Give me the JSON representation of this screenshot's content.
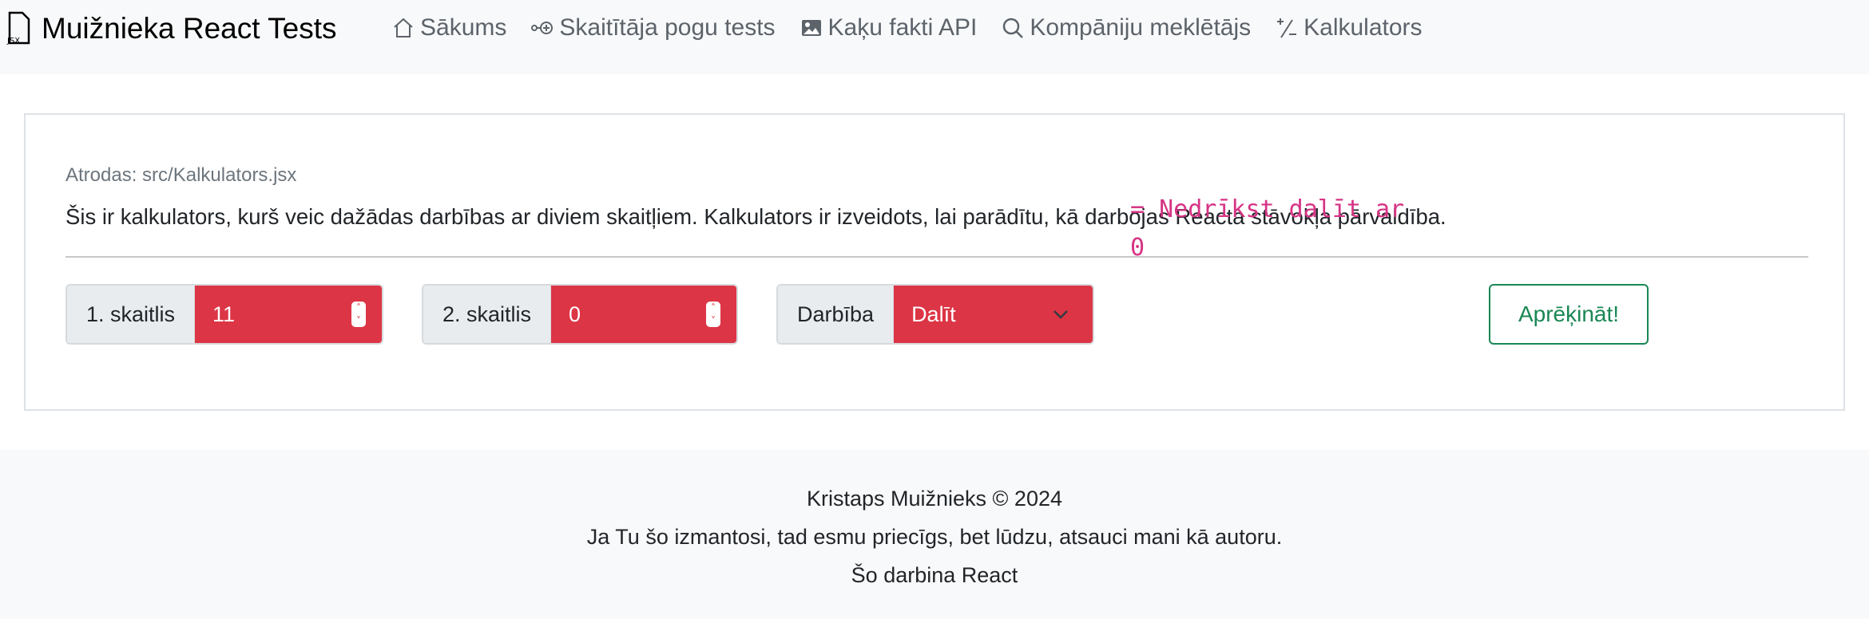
{
  "nav": {
    "brand": "Muižnieka React Tests",
    "brand_icon": "jsx-file-icon",
    "links": [
      {
        "label": "Sākums",
        "icon": "house-icon"
      },
      {
        "label": "Skaitītāja pogu tests",
        "icon": "node-plus-icon"
      },
      {
        "label": "Kaķu fakti API",
        "icon": "image-icon"
      },
      {
        "label": "Kompāniju meklētājs",
        "icon": "search-icon"
      },
      {
        "label": "Kalkulators",
        "icon": "plus-slash-minus-icon"
      }
    ]
  },
  "card": {
    "location": "Atrodas: src/Kalkulators.jsx",
    "description": "Šis ir kalkulators, kurš veic dažādas darbības ar diviem skaitļiem. Kalkulators ir izveidots, lai parādītu, kā darbojas Reacta stāvokļa pārvaldība.",
    "number1": {
      "label": "1. skaitlis",
      "value": "11"
    },
    "number2": {
      "label": "2. skaitlis",
      "value": "0"
    },
    "operation": {
      "label": "Darbība",
      "value": "Dalīt"
    },
    "result": "= Nedrīkst dalīt ar 0",
    "calculate_label": "Aprēķināt!",
    "colors": {
      "invalid": "#dc3545",
      "result": "#d63384",
      "button": "#198754"
    }
  },
  "footer": {
    "line1": "Kristaps Muižnieks © 2024",
    "line2": "Ja Tu šo izmantosi, tad esmu priecīgs, bet lūdzu, atsauci mani kā autoru.",
    "line3": "Šo darbina React"
  }
}
